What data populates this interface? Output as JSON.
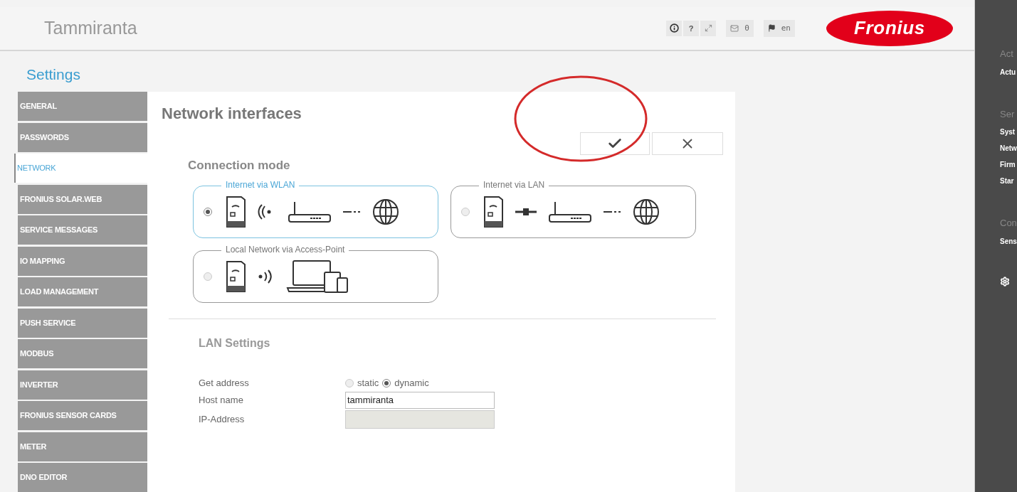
{
  "header": {
    "title": "Tammiranta",
    "toolbar": [
      {
        "kind": "info"
      },
      {
        "kind": "text",
        "label": "?"
      },
      {
        "kind": "expand"
      },
      {
        "kind": "mail",
        "label": "0"
      },
      {
        "kind": "flag",
        "label": "en"
      }
    ],
    "logo": "Fronius"
  },
  "page_title": "Settings",
  "sidebar": {
    "items": [
      {
        "label": "GENERAL",
        "selected": false
      },
      {
        "label": "PASSWORDS",
        "selected": false
      },
      {
        "label": "NETWORK",
        "selected": true
      },
      {
        "label": "FRONIUS SOLAR.WEB",
        "selected": false
      },
      {
        "label": "SERVICE MESSAGES",
        "selected": false
      },
      {
        "label": "IO MAPPING",
        "selected": false
      },
      {
        "label": "LOAD MANAGEMENT",
        "selected": false
      },
      {
        "label": "PUSH SERVICE",
        "selected": false
      },
      {
        "label": "MODBUS",
        "selected": false
      },
      {
        "label": "INVERTER",
        "selected": false
      },
      {
        "label": "FRONIUS SENSOR CARDS",
        "selected": false
      },
      {
        "label": "METER",
        "selected": false
      },
      {
        "label": "DNO EDITOR",
        "selected": false
      }
    ]
  },
  "panel": {
    "title": "Network interfaces",
    "section": "Connection mode",
    "modes": [
      {
        "label": "Internet via WLAN",
        "kind": "wlan",
        "selected": true
      },
      {
        "label": "Internet via LAN",
        "kind": "lan",
        "selected": false
      },
      {
        "label": "Local Network via Access-Point",
        "kind": "ap",
        "selected": false
      }
    ],
    "lan": {
      "title": "LAN Settings",
      "get_address": {
        "label": "Get address",
        "options": [
          {
            "label": "static",
            "selected": false
          },
          {
            "label": "dynamic",
            "selected": true
          }
        ]
      },
      "host_name": {
        "label": "Host name",
        "value": "tammiranta"
      },
      "ip_address": {
        "label": "IP-Address",
        "disabled": true
      }
    }
  },
  "right_panel": {
    "sections": [
      {
        "heading": "Act",
        "items": [
          "Actu"
        ]
      },
      {
        "heading": "Ser",
        "items": [
          "Syst",
          "Netw",
          "Firm",
          "Star"
        ]
      },
      {
        "heading": "Con",
        "items": [
          "Sens"
        ]
      }
    ]
  }
}
